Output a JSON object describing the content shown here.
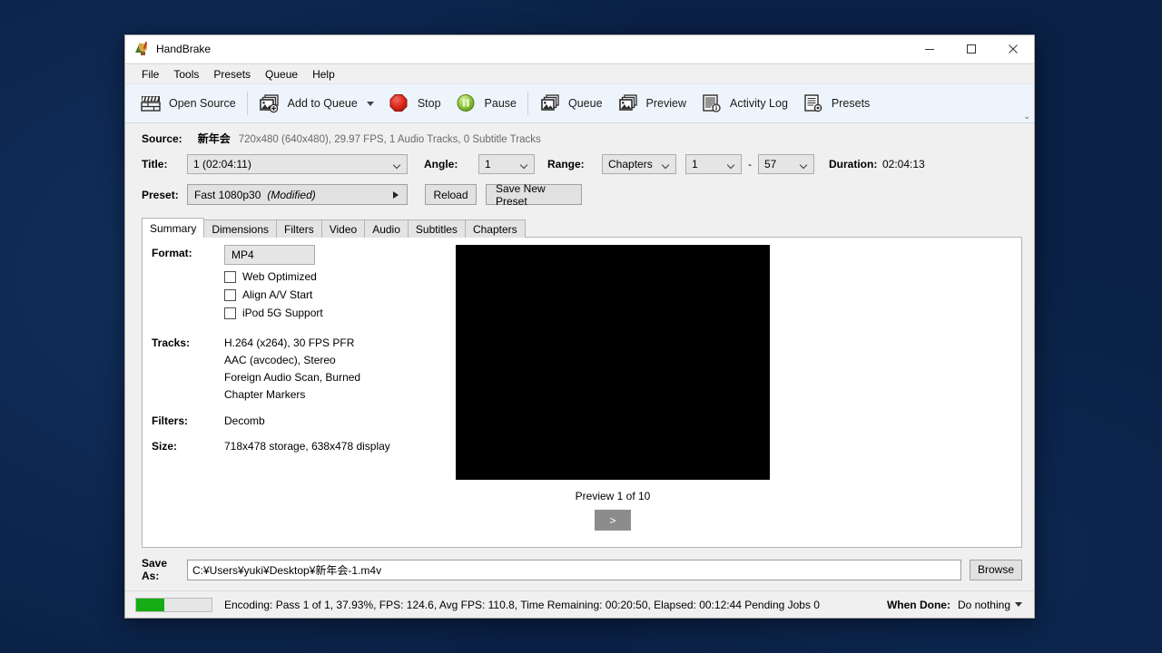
{
  "window": {
    "title": "HandBrake",
    "icon": "handbrake-cocktail-icon",
    "minimize": "minimize",
    "maximize": "maximize",
    "close": "close"
  },
  "menu": {
    "items": [
      {
        "label": "File"
      },
      {
        "label": "Tools"
      },
      {
        "label": "Presets"
      },
      {
        "label": "Queue"
      },
      {
        "label": "Help"
      }
    ]
  },
  "toolbar": {
    "open_source": "Open Source",
    "add_to_queue": "Add to Queue",
    "stop": "Stop",
    "pause": "Pause",
    "queue": "Queue",
    "preview": "Preview",
    "activity_log": "Activity Log",
    "presets": "Presets"
  },
  "source": {
    "label": "Source:",
    "name": "新年会",
    "details": "720x480 (640x480), 29.97 FPS, 1 Audio Tracks, 0 Subtitle Tracks"
  },
  "title_row": {
    "title_label": "Title:",
    "title_value": "1  (02:04:11)",
    "angle_label": "Angle:",
    "angle_value": "1",
    "range_label": "Range:",
    "range_value": "Chapters",
    "chapter_start": "1",
    "chapter_dash": "-",
    "chapter_end": "57",
    "duration_label": "Duration:",
    "duration_value": "02:04:13"
  },
  "preset": {
    "label": "Preset:",
    "value": "Fast 1080p30",
    "modified": "(Modified)",
    "reload": "Reload",
    "save_new_preset": "Save New Preset"
  },
  "tabs": [
    {
      "label": "Summary",
      "active": true
    },
    {
      "label": "Dimensions",
      "active": false
    },
    {
      "label": "Filters",
      "active": false
    },
    {
      "label": "Video",
      "active": false
    },
    {
      "label": "Audio",
      "active": false
    },
    {
      "label": "Subtitles",
      "active": false
    },
    {
      "label": "Chapters",
      "active": false
    }
  ],
  "summary": {
    "format_label": "Format:",
    "format_value": "MP4",
    "checkboxes": [
      {
        "label": "Web Optimized",
        "checked": false
      },
      {
        "label": "Align A/V Start",
        "checked": false
      },
      {
        "label": "iPod 5G Support",
        "checked": false
      }
    ],
    "tracks_label": "Tracks:",
    "tracks": [
      "H.264 (x264), 30 FPS PFR",
      "AAC (avcodec), Stereo",
      "Foreign Audio Scan, Burned",
      "Chapter Markers"
    ],
    "filters_label": "Filters:",
    "filters_value": "Decomb",
    "size_label": "Size:",
    "size_value": "718x478 storage, 638x478 display"
  },
  "preview": {
    "caption": "Preview 1 of 10",
    "next_label": ">"
  },
  "save_as": {
    "label": "Save As:",
    "value": "C:¥Users¥yuki¥Desktop¥新年会-1.m4v",
    "browse": "Browse"
  },
  "status": {
    "progress_percent": 37.93,
    "text": "Encoding: Pass 1 of 1,  37.93%, FPS: 124.6,  Avg FPS: 110.8,  Time Remaining: 00:20:50,  Elapsed: 00:12:44    Pending Jobs 0",
    "when_done_label": "When Done:",
    "when_done_value": "Do nothing"
  },
  "colors": {
    "desktop": "#0a2045",
    "toolbar_bg": "#eef4fb",
    "progress_green": "#16ac16",
    "stop_red": "#d62626",
    "pause_green": "#8cc63f"
  }
}
